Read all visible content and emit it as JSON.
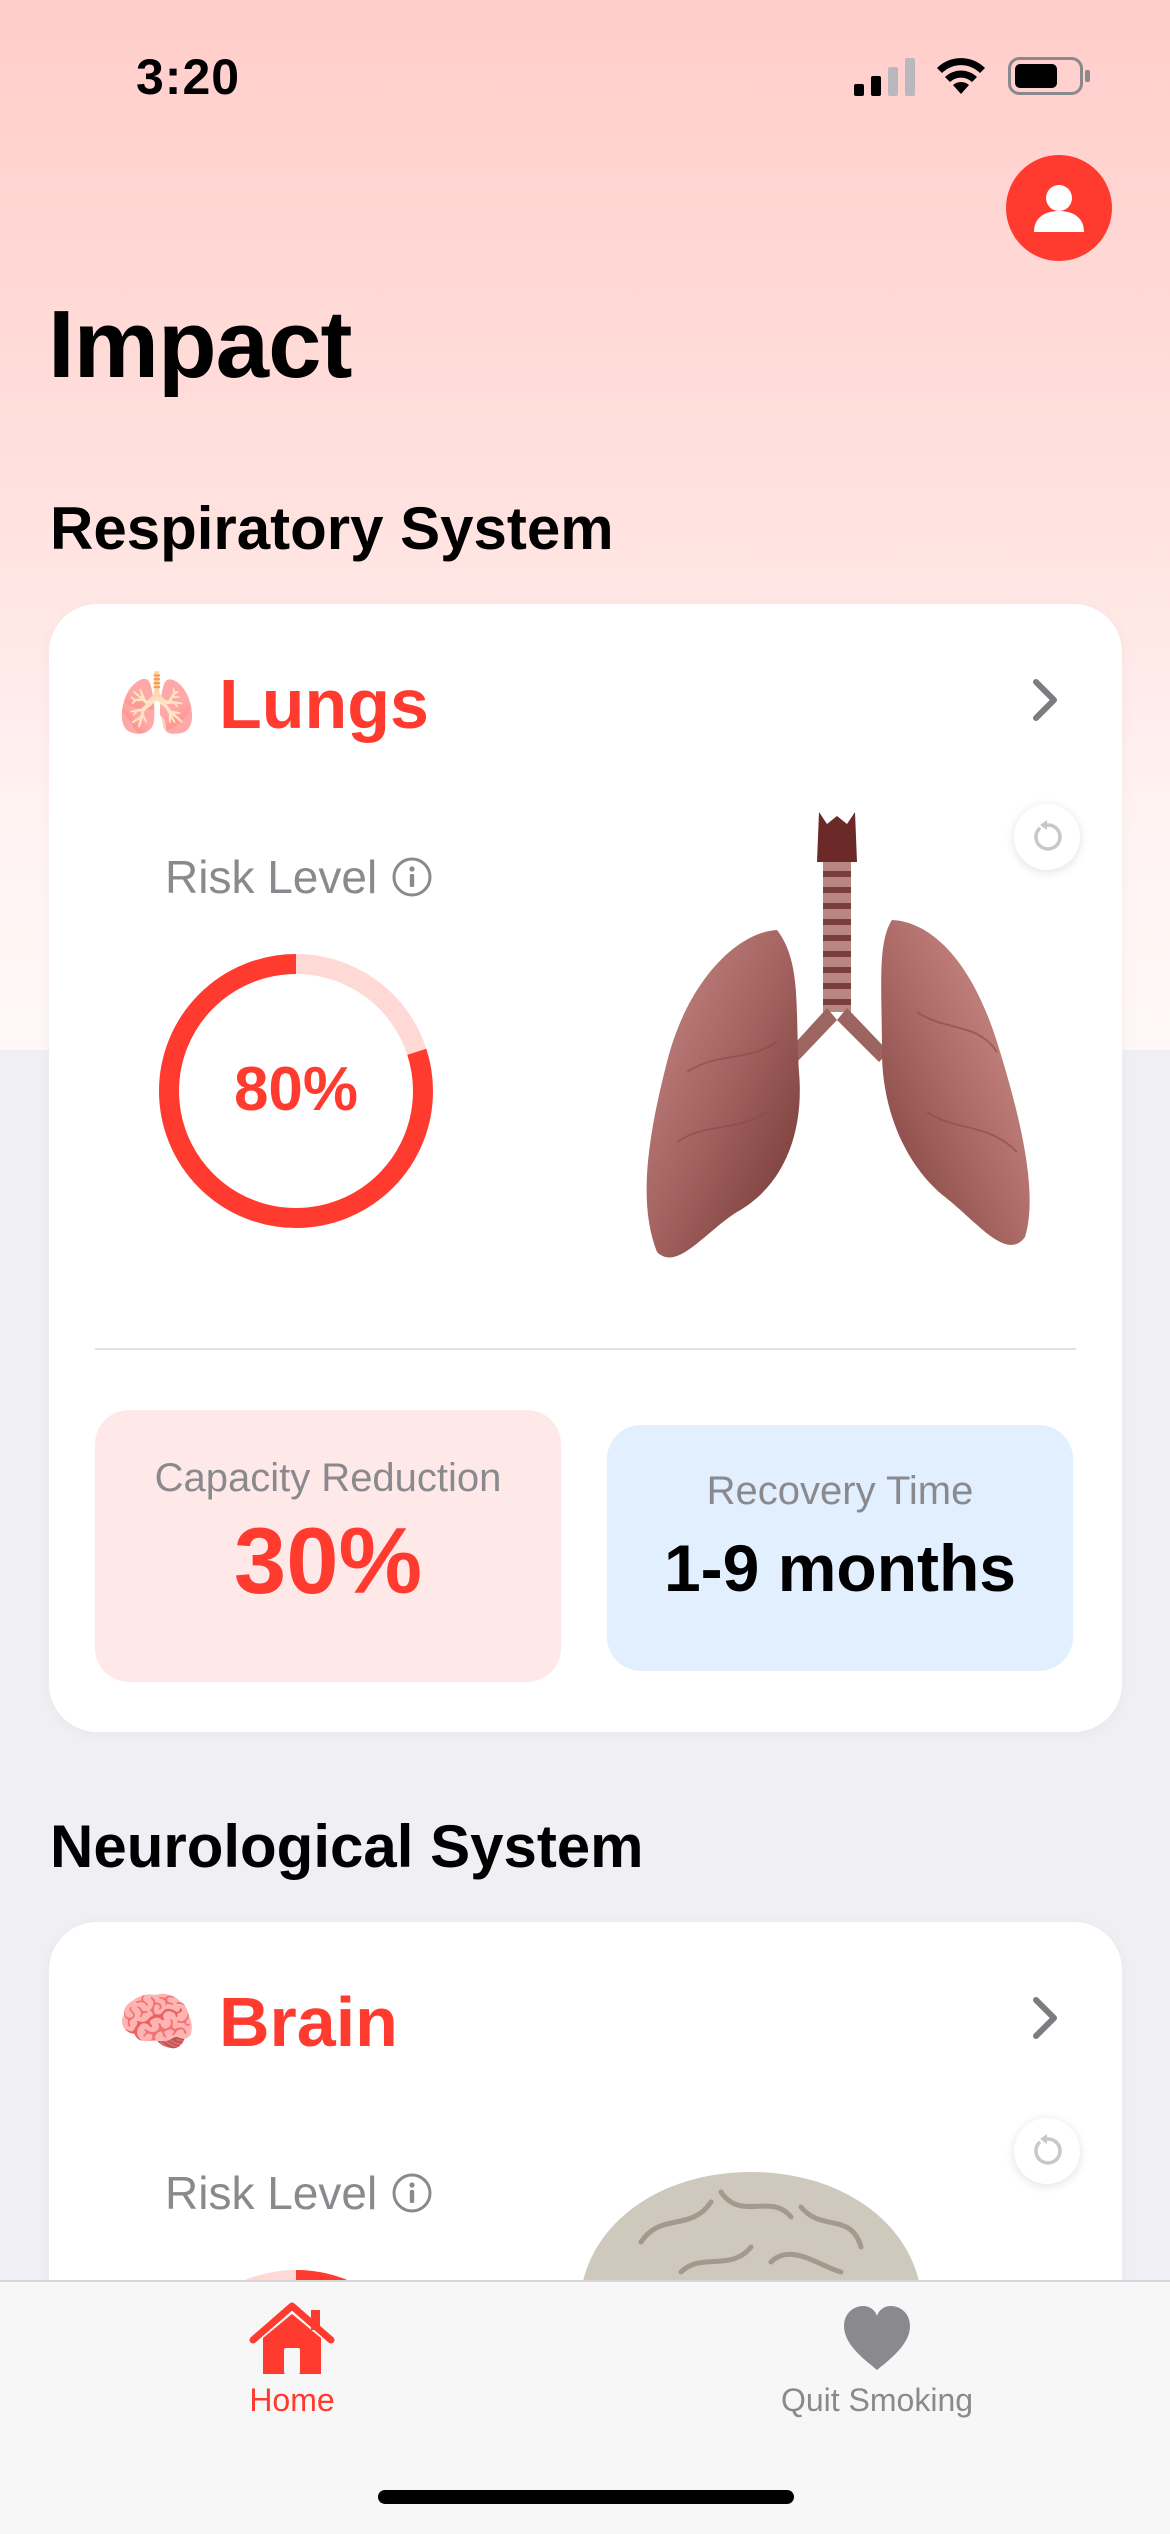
{
  "status_bar": {
    "time": "3:20"
  },
  "header": {
    "title": "Impact",
    "profile_icon": "person-icon"
  },
  "sections": [
    {
      "title": "Respiratory System",
      "organ": {
        "emoji": "🫁",
        "name": "Lungs",
        "risk_label": "Risk Level",
        "risk_value": 80,
        "risk_text": "80%",
        "stat1": {
          "label": "Capacity Reduction",
          "value": "30%"
        },
        "stat2": {
          "label": "Recovery Time",
          "value": "1-9 months"
        }
      }
    },
    {
      "title": "Neurological System",
      "organ": {
        "emoji": "🧠",
        "name": "Brain",
        "risk_label": "Risk Level"
      }
    }
  ],
  "tabs": [
    {
      "label": "Home",
      "icon": "house-icon",
      "active": true
    },
    {
      "label": "Quit Smoking",
      "icon": "heart-icon",
      "active": false
    }
  ],
  "colors": {
    "accent": "#ff3b30",
    "ring_track": "#ffd9d6",
    "capacity_bg": "#ffe9e8",
    "recovery_bg": "#e2efff",
    "inactive_tab": "#8a8a8e"
  }
}
